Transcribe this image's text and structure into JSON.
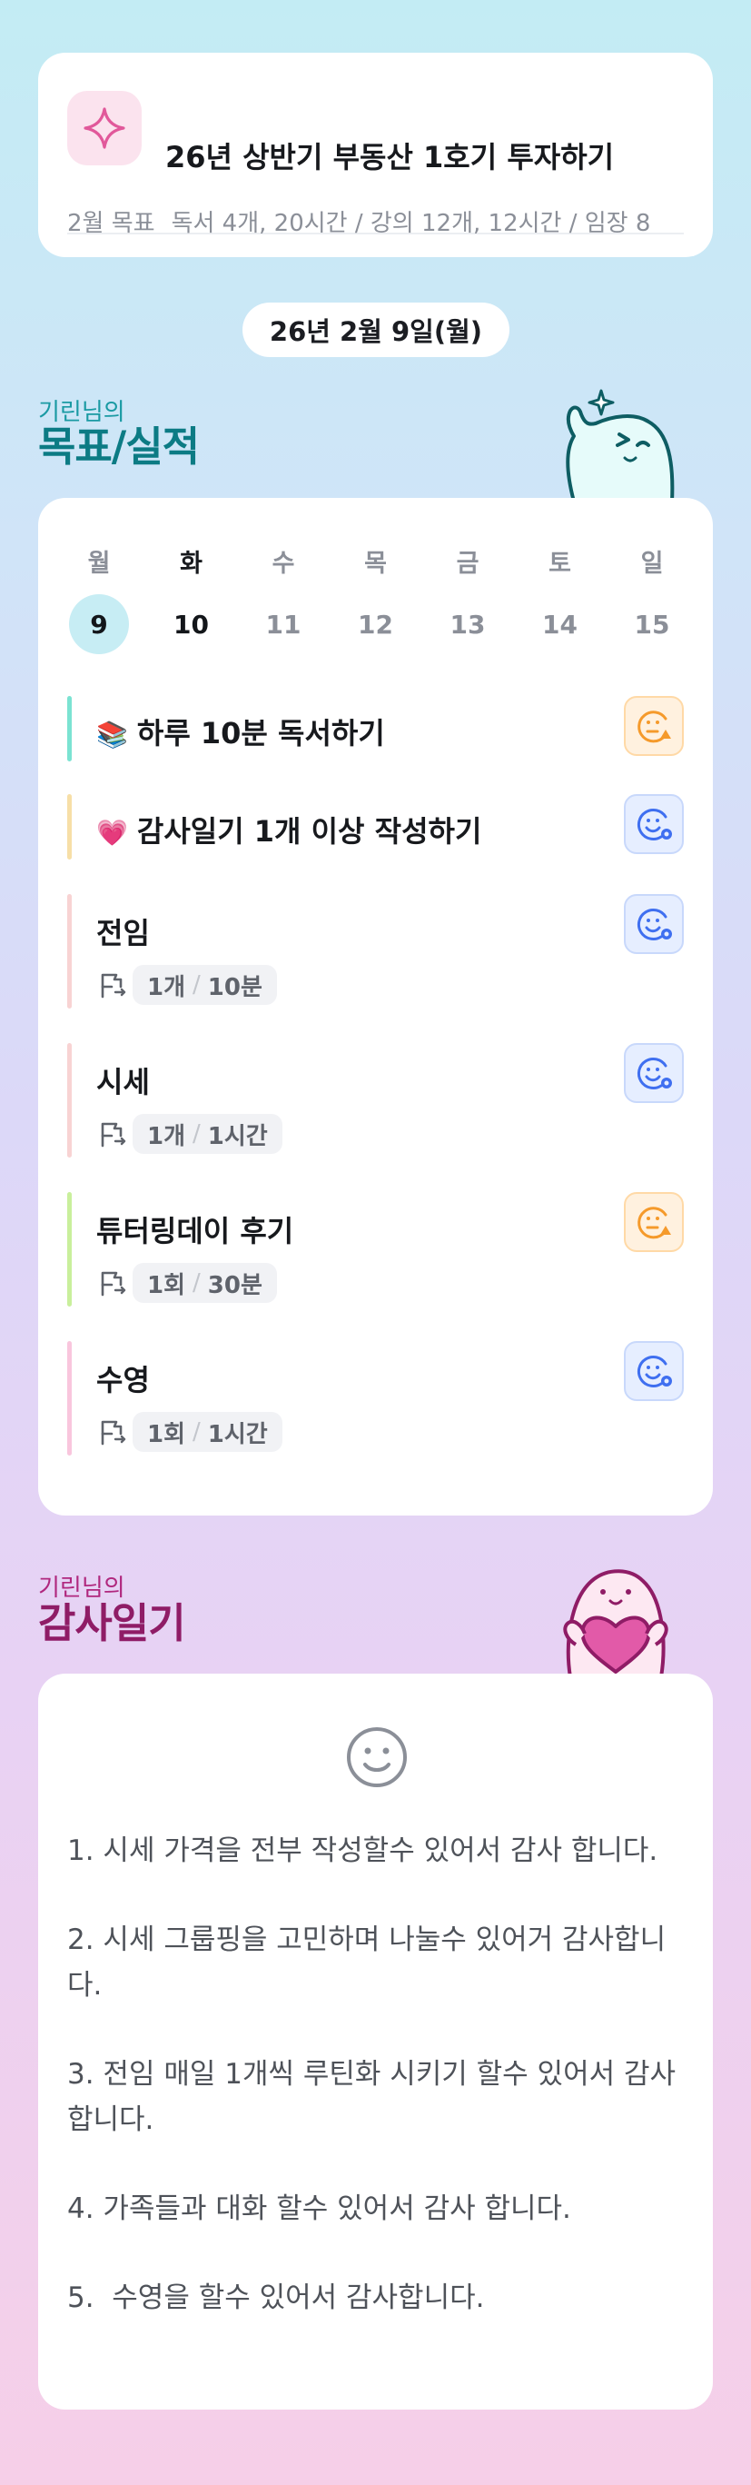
{
  "goal": {
    "icon": "sparkle-icon",
    "title": "26년 상반기 부동산 1호기 투자하기",
    "sub_label": "2월 목표",
    "sub_text": "독서 4개, 20시간 / 강의 12개, 12시간 / 임장 8"
  },
  "date": "26년 2월 9일(월)",
  "tasks_section": {
    "small": "기린님의",
    "big": "목표/실적",
    "mascot": "waving-mascot"
  },
  "week": {
    "labels": [
      "월",
      "화",
      "수",
      "목",
      "금",
      "토",
      "일"
    ],
    "days": [
      "9",
      "10",
      "11",
      "12",
      "13",
      "14",
      "15"
    ],
    "today_index": 0
  },
  "tasks": [
    {
      "name": "하루 10분 독서하기",
      "emoji": "📚",
      "status": "warn",
      "bar_color": "#7be3d2"
    },
    {
      "name": "감사일기 1개 이상 작성하기",
      "emoji": "💗",
      "status": "info",
      "bar_color": "#f7dfa7"
    },
    {
      "name": "전임",
      "count": "1개",
      "time": "10분",
      "status": "info",
      "bar_color": "#f8d3d3"
    },
    {
      "name": "시세",
      "count": "1개",
      "time": "1시간",
      "status": "info",
      "bar_color": "#f8d3d3"
    },
    {
      "name": "튜터링데이 후기",
      "count": "1회",
      "time": "30분",
      "status": "warn",
      "bar_color": "#c9ef9c"
    },
    {
      "name": "수영",
      "count": "1회",
      "time": "1시간",
      "status": "info",
      "bar_color": "#f9c6dd"
    }
  ],
  "diary_section": {
    "small": "기린님의",
    "big": "감사일기",
    "mascot": "heart-mascot"
  },
  "diary": {
    "icon": "smile-icon",
    "items": [
      "1. 시세 가격을 전부 작성할수 있어서 감사 합니다.",
      "2. 시세 그룹핑을 고민하며 나눌수 있어거 감사합니다.",
      "3. 전임 매일 1개씩 루틴화 시키기 할수 있어서 감사 합니다.",
      "4. 가족들과 대화 할수 있어서 감사 합니다.",
      "5.  수영을 할수 있어서 감사합니다."
    ]
  },
  "colors": {
    "warn": "#f59a2b",
    "info": "#3f6ff0",
    "teal": "#0c7b84",
    "magenta": "#8f1c66"
  }
}
